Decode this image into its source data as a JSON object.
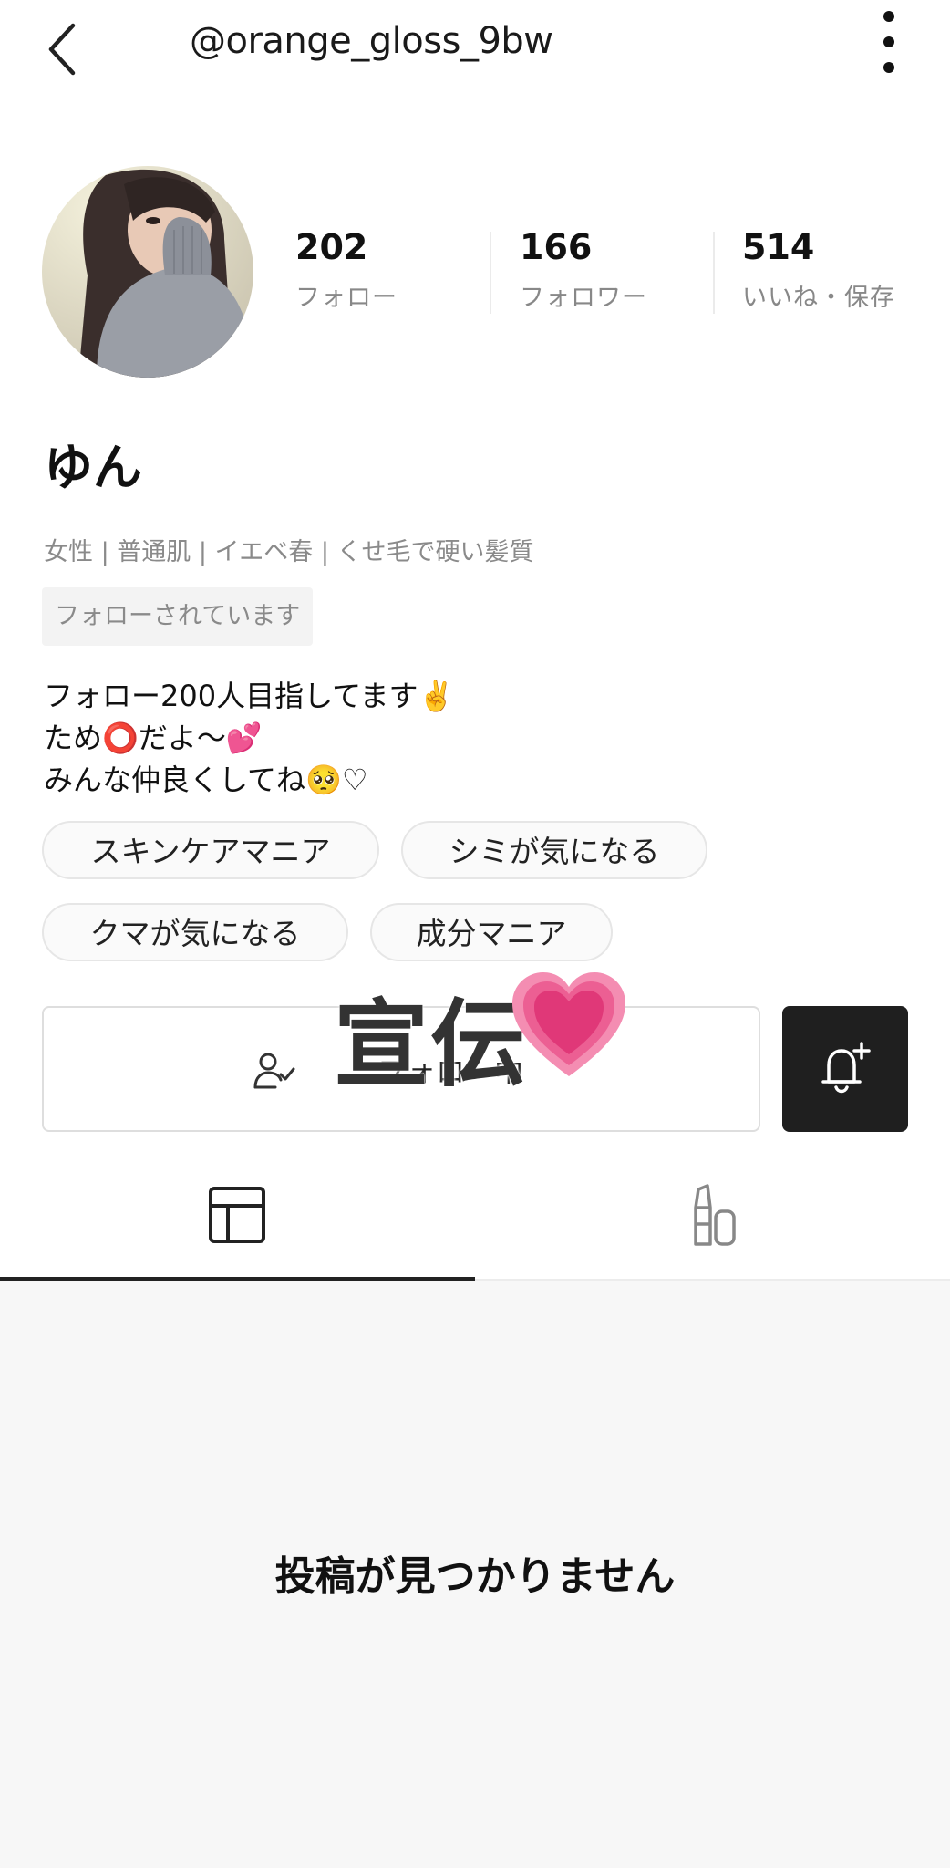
{
  "header": {
    "handle": "@orange_gloss_9bw"
  },
  "profile": {
    "stats": [
      {
        "value": "202",
        "label": "フォロー"
      },
      {
        "value": "166",
        "label": "フォロワー"
      },
      {
        "value": "514",
        "label": "いいね・保存"
      }
    ],
    "name": "ゆん",
    "attributes": "女性 | 普通肌 | イエベ春 | くせ毛で硬い髪質",
    "follows_you": "フォローされています",
    "bio": [
      "フォロー200人目指してます✌️",
      "ため⭕だよ〜💕",
      "みんな仲良くしてね🥺♡"
    ],
    "tags": [
      "スキンケアマニア",
      "シミが気になる",
      "クマが気になる",
      "成分マニア"
    ]
  },
  "actions": {
    "follow_label": "フォロー中"
  },
  "overlay": {
    "stamp": "宣伝"
  },
  "tabs": [
    {
      "icon": "grid-icon",
      "active": true
    },
    {
      "icon": "cosmetics-icon",
      "active": false
    }
  ],
  "content": {
    "empty_message": "投稿が見つかりません"
  },
  "colors": {
    "primary_text": "#111111",
    "secondary_text": "#8a8a8a",
    "bell_button": "#1f1f1f",
    "heart": "#e8407a"
  }
}
